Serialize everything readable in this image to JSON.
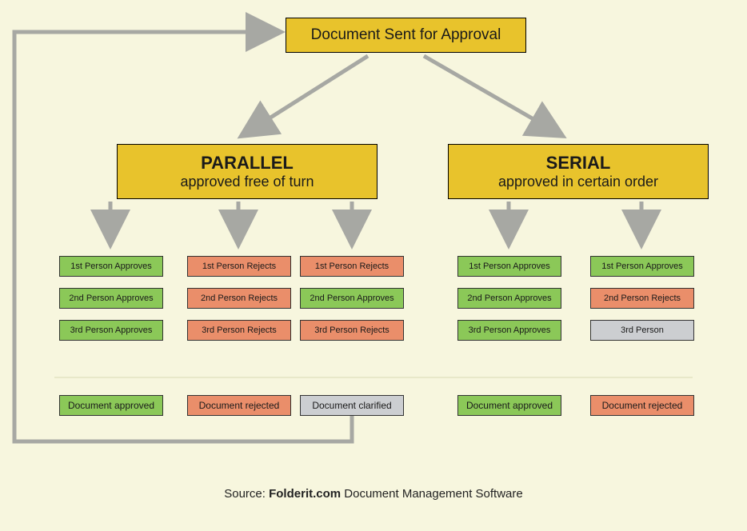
{
  "top_box": "Document Sent for Approval",
  "parallel": {
    "title": "PARALLEL",
    "subtitle": "approved free of turn"
  },
  "serial": {
    "title": "SERIAL",
    "subtitle": "approved in certain order"
  },
  "cols": {
    "p1": [
      "1st Person Approves",
      "2nd Person Approves",
      "3rd Person Approves"
    ],
    "p2": [
      "1st Person Rejects",
      "2nd Person Rejects",
      "3rd Person Rejects"
    ],
    "p3": [
      "1st Person Rejects",
      "2nd Person Approves",
      "3rd Person Rejects"
    ],
    "s1": [
      "1st Person Approves",
      "2nd Person Approves",
      "3rd Person Approves"
    ],
    "s2_0": "1st Person Approves",
    "s2_1": "2nd Person Rejects",
    "s2_2": "3rd Person"
  },
  "outcomes": {
    "p1": "Document approved",
    "p2": "Document rejected",
    "p3": "Document clarified",
    "s1": "Document approved",
    "s2": "Document rejected"
  },
  "source_prefix": "Source: ",
  "source_brand": "Folderit.com",
  "source_suffix": " Document Management Software"
}
